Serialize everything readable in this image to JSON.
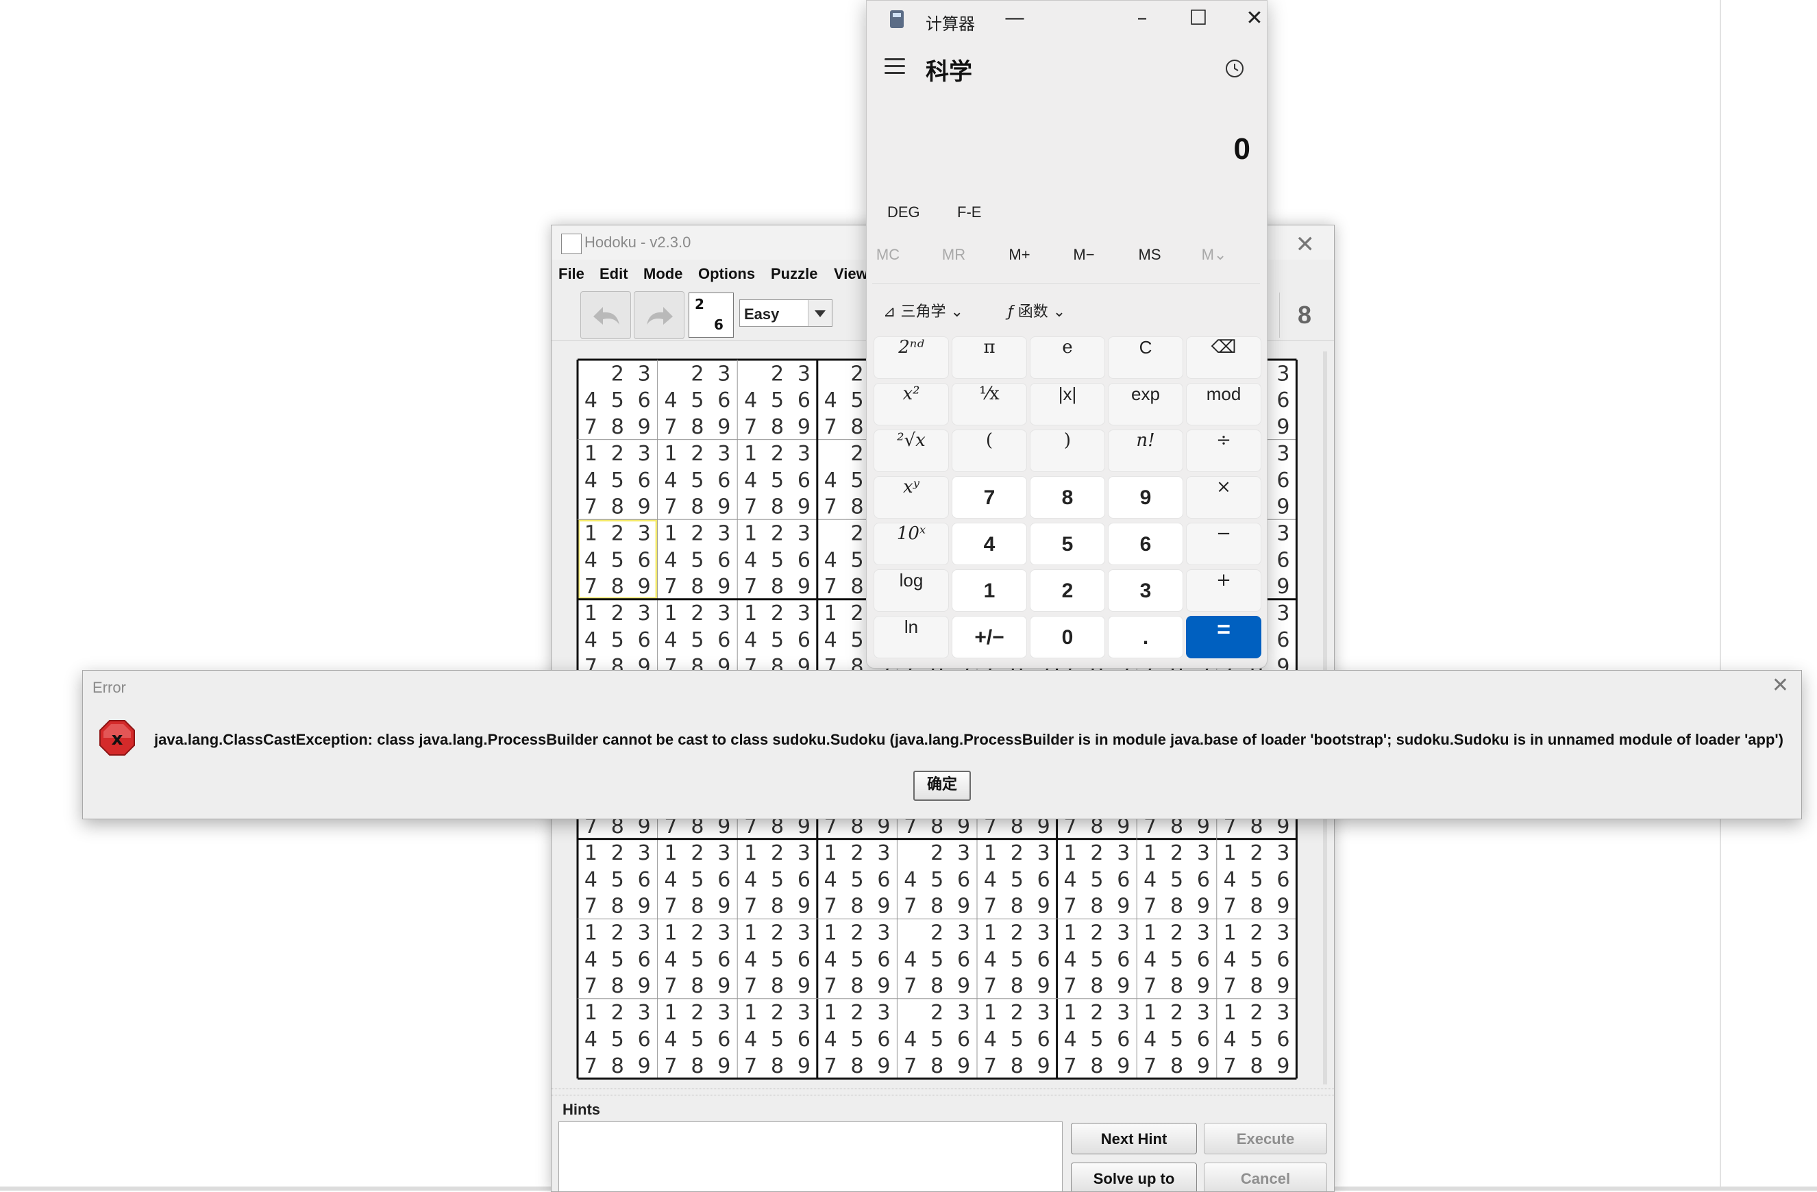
{
  "hodoku": {
    "title": "Hodoku - v2.3.0",
    "menu": [
      "File",
      "Edit",
      "Mode",
      "Options",
      "Puzzle",
      "View"
    ],
    "level": "Easy",
    "toolbar_digit": "8",
    "hints_label": "Hints",
    "buttons": {
      "next_hint": "Next Hint",
      "execute": "Execute",
      "solve_up_to": "Solve up to",
      "cancel": "Cancel"
    },
    "icon_digits": [
      "2",
      "6"
    ],
    "candidate_digits": [
      "1",
      "2",
      "3",
      "4",
      "5",
      "6",
      "7",
      "8",
      "9"
    ]
  },
  "calculator": {
    "title": "计算器",
    "mode": "科学",
    "display": "0",
    "flags": [
      "DEG",
      "F-E"
    ],
    "memory": [
      "MC",
      "MR",
      "M+",
      "M−",
      "MS",
      "M⌄"
    ],
    "trig_label": "三角学",
    "func_label": "函数",
    "keys": [
      [
        "2ⁿᵈ",
        "π",
        "e",
        "C",
        "⌫"
      ],
      [
        "x²",
        "¹⁄x",
        "|x|",
        "exp",
        "mod"
      ],
      [
        "²√x",
        "(",
        ")",
        "n!",
        "÷"
      ],
      [
        "xʸ",
        "7",
        "8",
        "9",
        "×"
      ],
      [
        "10ˣ",
        "4",
        "5",
        "6",
        "−"
      ],
      [
        "log",
        "1",
        "2",
        "3",
        "+"
      ],
      [
        "ln",
        "+/−",
        "0",
        ".",
        "="
      ]
    ]
  },
  "error_dialog": {
    "title": "Error",
    "message": "java.lang.ClassCastException: class java.lang.ProcessBuilder cannot be cast to class sudoku.Sudoku (java.lang.ProcessBuilder is in module java.base of loader 'bootstrap'; sudoku.Sudoku is in unnamed module of loader 'app')",
    "ok_label": "确定"
  },
  "colors": {
    "accent": "#0060c0",
    "highlight": "#f2e86a",
    "error_icon": "#d42a2a"
  }
}
